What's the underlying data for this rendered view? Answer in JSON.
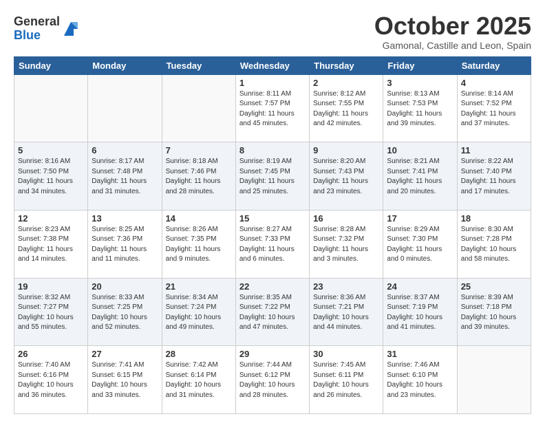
{
  "header": {
    "logo_general": "General",
    "logo_blue": "Blue",
    "month": "October 2025",
    "location": "Gamonal, Castille and Leon, Spain"
  },
  "weekdays": [
    "Sunday",
    "Monday",
    "Tuesday",
    "Wednesday",
    "Thursday",
    "Friday",
    "Saturday"
  ],
  "weeks": [
    [
      {
        "num": "",
        "info": ""
      },
      {
        "num": "",
        "info": ""
      },
      {
        "num": "",
        "info": ""
      },
      {
        "num": "1",
        "info": "Sunrise: 8:11 AM\nSunset: 7:57 PM\nDaylight: 11 hours\nand 45 minutes."
      },
      {
        "num": "2",
        "info": "Sunrise: 8:12 AM\nSunset: 7:55 PM\nDaylight: 11 hours\nand 42 minutes."
      },
      {
        "num": "3",
        "info": "Sunrise: 8:13 AM\nSunset: 7:53 PM\nDaylight: 11 hours\nand 39 minutes."
      },
      {
        "num": "4",
        "info": "Sunrise: 8:14 AM\nSunset: 7:52 PM\nDaylight: 11 hours\nand 37 minutes."
      }
    ],
    [
      {
        "num": "5",
        "info": "Sunrise: 8:16 AM\nSunset: 7:50 PM\nDaylight: 11 hours\nand 34 minutes."
      },
      {
        "num": "6",
        "info": "Sunrise: 8:17 AM\nSunset: 7:48 PM\nDaylight: 11 hours\nand 31 minutes."
      },
      {
        "num": "7",
        "info": "Sunrise: 8:18 AM\nSunset: 7:46 PM\nDaylight: 11 hours\nand 28 minutes."
      },
      {
        "num": "8",
        "info": "Sunrise: 8:19 AM\nSunset: 7:45 PM\nDaylight: 11 hours\nand 25 minutes."
      },
      {
        "num": "9",
        "info": "Sunrise: 8:20 AM\nSunset: 7:43 PM\nDaylight: 11 hours\nand 23 minutes."
      },
      {
        "num": "10",
        "info": "Sunrise: 8:21 AM\nSunset: 7:41 PM\nDaylight: 11 hours\nand 20 minutes."
      },
      {
        "num": "11",
        "info": "Sunrise: 8:22 AM\nSunset: 7:40 PM\nDaylight: 11 hours\nand 17 minutes."
      }
    ],
    [
      {
        "num": "12",
        "info": "Sunrise: 8:23 AM\nSunset: 7:38 PM\nDaylight: 11 hours\nand 14 minutes."
      },
      {
        "num": "13",
        "info": "Sunrise: 8:25 AM\nSunset: 7:36 PM\nDaylight: 11 hours\nand 11 minutes."
      },
      {
        "num": "14",
        "info": "Sunrise: 8:26 AM\nSunset: 7:35 PM\nDaylight: 11 hours\nand 9 minutes."
      },
      {
        "num": "15",
        "info": "Sunrise: 8:27 AM\nSunset: 7:33 PM\nDaylight: 11 hours\nand 6 minutes."
      },
      {
        "num": "16",
        "info": "Sunrise: 8:28 AM\nSunset: 7:32 PM\nDaylight: 11 hours\nand 3 minutes."
      },
      {
        "num": "17",
        "info": "Sunrise: 8:29 AM\nSunset: 7:30 PM\nDaylight: 11 hours\nand 0 minutes."
      },
      {
        "num": "18",
        "info": "Sunrise: 8:30 AM\nSunset: 7:28 PM\nDaylight: 10 hours\nand 58 minutes."
      }
    ],
    [
      {
        "num": "19",
        "info": "Sunrise: 8:32 AM\nSunset: 7:27 PM\nDaylight: 10 hours\nand 55 minutes."
      },
      {
        "num": "20",
        "info": "Sunrise: 8:33 AM\nSunset: 7:25 PM\nDaylight: 10 hours\nand 52 minutes."
      },
      {
        "num": "21",
        "info": "Sunrise: 8:34 AM\nSunset: 7:24 PM\nDaylight: 10 hours\nand 49 minutes."
      },
      {
        "num": "22",
        "info": "Sunrise: 8:35 AM\nSunset: 7:22 PM\nDaylight: 10 hours\nand 47 minutes."
      },
      {
        "num": "23",
        "info": "Sunrise: 8:36 AM\nSunset: 7:21 PM\nDaylight: 10 hours\nand 44 minutes."
      },
      {
        "num": "24",
        "info": "Sunrise: 8:37 AM\nSunset: 7:19 PM\nDaylight: 10 hours\nand 41 minutes."
      },
      {
        "num": "25",
        "info": "Sunrise: 8:39 AM\nSunset: 7:18 PM\nDaylight: 10 hours\nand 39 minutes."
      }
    ],
    [
      {
        "num": "26",
        "info": "Sunrise: 7:40 AM\nSunset: 6:16 PM\nDaylight: 10 hours\nand 36 minutes."
      },
      {
        "num": "27",
        "info": "Sunrise: 7:41 AM\nSunset: 6:15 PM\nDaylight: 10 hours\nand 33 minutes."
      },
      {
        "num": "28",
        "info": "Sunrise: 7:42 AM\nSunset: 6:14 PM\nDaylight: 10 hours\nand 31 minutes."
      },
      {
        "num": "29",
        "info": "Sunrise: 7:44 AM\nSunset: 6:12 PM\nDaylight: 10 hours\nand 28 minutes."
      },
      {
        "num": "30",
        "info": "Sunrise: 7:45 AM\nSunset: 6:11 PM\nDaylight: 10 hours\nand 26 minutes."
      },
      {
        "num": "31",
        "info": "Sunrise: 7:46 AM\nSunset: 6:10 PM\nDaylight: 10 hours\nand 23 minutes."
      },
      {
        "num": "",
        "info": ""
      }
    ]
  ]
}
